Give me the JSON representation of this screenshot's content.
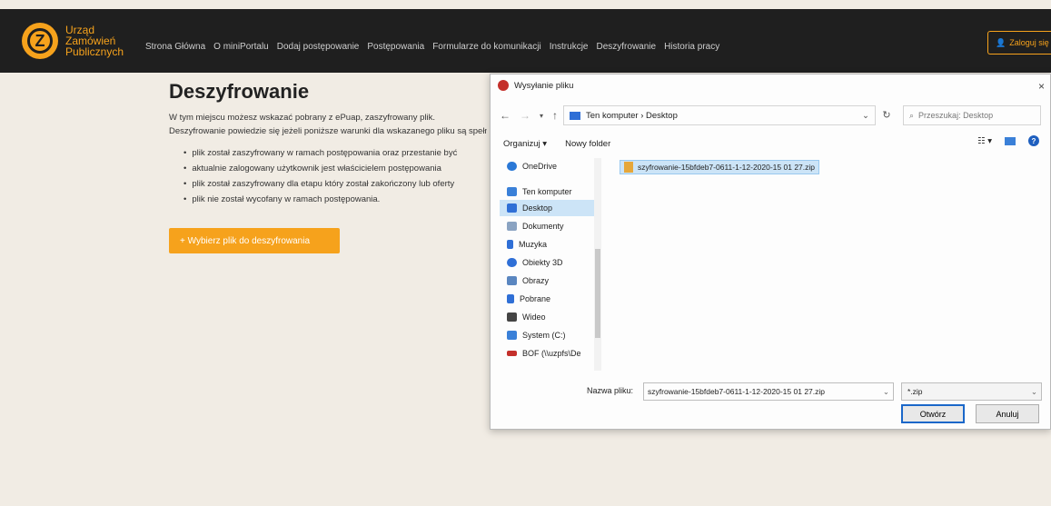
{
  "brand": {
    "line1": "Urząd",
    "line2": "Zamówień",
    "line3": "Publicznych",
    "logo_letter": "Z"
  },
  "nav": {
    "items": [
      "Strona Główna",
      "O miniPortalu",
      "Dodaj postępowanie",
      "Postępowania",
      "Formularze do komunikacji",
      "Instrukcje",
      "Deszyfrowanie",
      "Historia pracy"
    ]
  },
  "user_button": {
    "label": "Zaloguj się"
  },
  "page": {
    "title": "Deszyfrowanie",
    "desc_line1": "W tym miejscu możesz wskazać pobrany z ePuap, zaszyfrowany plik.",
    "desc_line2": "Deszyfrowanie powiedzie się jeżeli poniższe warunki dla wskazanego pliku są spełnione:",
    "conditions": [
      "plik został zaszyfrowany w ramach postępowania oraz przestanie być",
      "aktualnie zalogowany użytkownik jest właścicielem postępowania",
      "plik został zaszyfrowany dla etapu który został zakończony lub oferty",
      "plik nie został wycofany w ramach postępowania."
    ],
    "select_button": "+ Wybierz plik do deszyfrowania"
  },
  "dialog": {
    "title": "Wysyłanie pliku",
    "close": "×",
    "breadcrumb": "Ten komputer  ›  Desktop",
    "search_placeholder": "Przeszukaj: Desktop",
    "organize": "Organizuj ▾",
    "new_folder": "Nowy folder",
    "nav_items": [
      {
        "label": "OneDrive",
        "icon": "cloud-icon",
        "color": "#2a78d6"
      },
      {
        "label": "Ten komputer",
        "icon": "computer-icon",
        "color": "#3a80d8"
      },
      {
        "label": "Desktop",
        "icon": "folder-icon",
        "color": "#2f6fd6"
      },
      {
        "label": "Dokumenty",
        "icon": "documents-icon",
        "color": "#8aa3c2"
      },
      {
        "label": "Muzyka",
        "icon": "music-icon",
        "color": "#2f6fd6"
      },
      {
        "label": "Obiekty 3D",
        "icon": "cube-icon",
        "color": "#2f6fd6"
      },
      {
        "label": "Obrazy",
        "icon": "pictures-icon",
        "color": "#5a86c0"
      },
      {
        "label": "Pobrane",
        "icon": "download-icon",
        "color": "#2f6fd6"
      },
      {
        "label": "Wideo",
        "icon": "video-icon",
        "color": "#444444"
      },
      {
        "label": "System (C:)",
        "icon": "drive-icon",
        "color": "#3a80d8"
      },
      {
        "label": "BOF (\\\\uzpfs\\De",
        "icon": "network-drive-icon",
        "color": "#c4302b"
      }
    ],
    "selected_file": "szyfrowanie-15bfdeb7-0611-1-12-2020-15 01 27.zip",
    "filename_label": "Nazwa pliku:",
    "filename_value": "szyfrowanie-15bfdeb7-0611-1-12-2020-15 01 27.zip",
    "filter": "*.zip",
    "open_button": "Otwórz",
    "cancel_button": "Anuluj"
  },
  "colors": {
    "accent": "#f6a21c",
    "topbar": "#1f1f1f",
    "selection": "#cce4f7"
  }
}
